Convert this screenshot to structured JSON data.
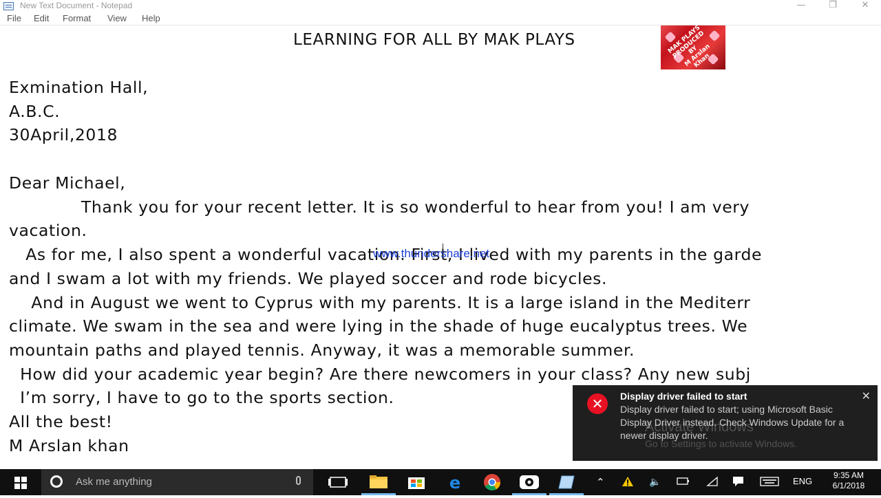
{
  "window": {
    "title": "New Text Document - Notepad",
    "controls": {
      "minimize": "—",
      "maximize": "❐",
      "close": "✕"
    }
  },
  "menu": [
    "File",
    "Edit",
    "Format",
    "View",
    "Help"
  ],
  "document": {
    "heading": "LEARNING FOR ALL BY MAK PLAYS",
    "logo_text": "MAK PLAYS PRODUCED BY M Arslan Khan",
    "lines": [
      "Exmination Hall,",
      "A.B.C.",
      "30April,2018",
      "",
      "Dear Michael,",
      "             Thank you for your recent letter. It is so wonderful to hear from you! I am very",
      "vacation.",
      "   As for me, I also spent a wonderful vacation. First, I lived with my parents in the garde",
      "and I swam a lot with my friends. We played soccer and rode bicycles.",
      "    And in August we went to Cyprus with my parents. It is a large island in the Mediterr",
      "climate. We swam in the sea and were lying in the shade of huge eucalyptus trees. We",
      "mountain paths and played tennis. Anyway, it was a memorable summer.",
      "  How did your academic year begin? Are there newcomers in your class? Any new subj",
      "  I’m sorry, I have to go to the sports section.",
      "All the best!",
      "M Arslan khan"
    ],
    "watermark": "www.thundershare.net"
  },
  "notification": {
    "title": "Display driver failed to start",
    "body": "Display driver failed to start; using Microsoft Basic Display Driver instead. Check Windows Update for a newer display driver.",
    "close": "✕"
  },
  "activate_windows": {
    "line1": "Activate Windows",
    "line2": "Go to Settings to activate Windows."
  },
  "taskbar": {
    "search_placeholder": "Ask me anything",
    "language": "ENG",
    "time": "9:35 AM",
    "date": "6/1/2018"
  },
  "colors": {
    "taskbar_bg": "#101010",
    "toast_bg": "#1f1f1f",
    "error_red": "#e81123",
    "edge_blue": "#0078d7"
  }
}
